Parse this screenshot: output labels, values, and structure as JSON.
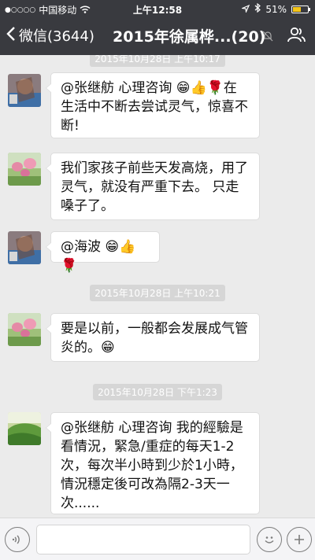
{
  "status": {
    "carrier": "中国移动",
    "time": "上午12:58",
    "battery": "51%",
    "battery_level": 0.51
  },
  "nav": {
    "back_label": "微信(3644)",
    "title": "2015年徐属桦...(20)"
  },
  "messages": [
    {
      "text": "@张继舫 心理咨询 😁👍🌹在生活中不断去尝试灵气，惊喜不断!"
    },
    {
      "text": "我们家孩子前些天发高烧，用了灵气，就没有严重下去。 只走嗓子了。"
    },
    {
      "text": "@海波 😁👍🌹"
    },
    {
      "text": "要是以前，一般都会发展成气管炎的。😁"
    },
    {
      "text": "@张继舫 心理咨询 我的經驗是看情況，緊急/重症的每天1-2次，每次半小時到少於1小時，情況穩定後可改為隔2-3天一次......"
    }
  ],
  "timestamps": {
    "t0": "2015年10月28日 上午10:17",
    "t1": "2015年10月28日 上午10:21",
    "t2": "2015年10月28日 下午1:23"
  },
  "colors": {
    "header": "#393a3f",
    "background": "#ebebeb",
    "timestamp_bg": "#d6d6d6"
  },
  "icons": {
    "back": "chevron-left-icon",
    "mute": "mute-bell-icon",
    "people": "group-members-icon",
    "voice": "voice-icon",
    "emoji": "emoji-icon",
    "plus": "plus-icon"
  }
}
